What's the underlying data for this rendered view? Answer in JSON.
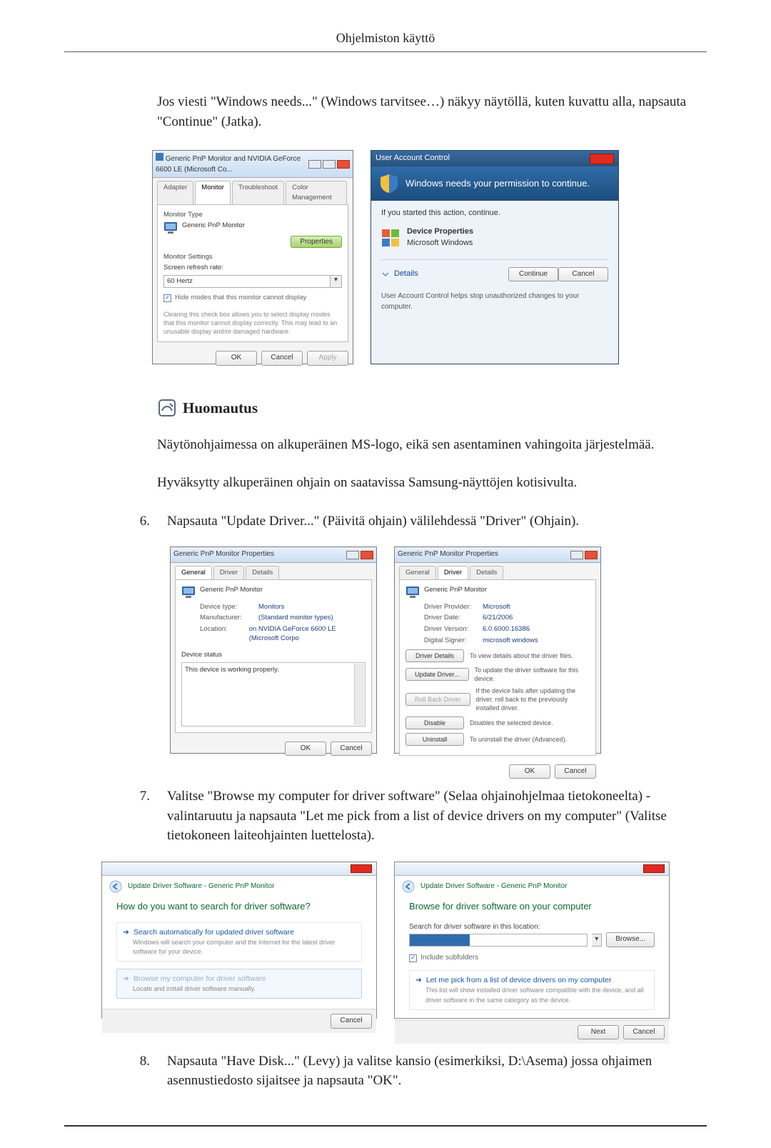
{
  "running_head": "Ohjelmiston käyttö",
  "para1": "Jos viesti \"Windows needs...\" (Windows tarvitsee…) näkyy näytöllä, kuten kuvattu alla, napsauta \"Continue\" (Jatka).",
  "note": {
    "heading": "Huomautus",
    "p1": "Näytönohjaimessa on alkuperäinen MS-logo, eikä sen asentaminen vahingoita järjestelmää.",
    "p2": "Hyväksytty alkuperäinen ohjain on saatavissa Samsung-näyttöjen kotisivulta."
  },
  "steps": {
    "s6": {
      "num": "6.",
      "text": "Napsauta \"Update Driver...\" (Päivitä ohjain) välilehdessä \"Driver\" (Ohjain)."
    },
    "s7": {
      "num": "7.",
      "text": "Valitse \"Browse my computer for driver software\" (Selaa ohjainohjelmaa tietokoneelta) -valintaruutu ja napsauta \"Let me pick from a list of device drivers on my computer\" (Valitse tietokoneen laiteohjainten luettelosta)."
    },
    "s8": {
      "num": "8.",
      "text": "Napsauta \"Have Disk...\" (Levy) ja valitse kansio (esimerkiksi, D:\\Asema) jossa ohjaimen asennustiedosto sijaitsee ja napsauta \"OK\"."
    }
  },
  "adapter_dialog": {
    "title": "Generic PnP Monitor and NVIDIA GeForce 6600 LE (Microsoft Co...",
    "tabs": [
      "Adapter",
      "Monitor",
      "Troubleshoot",
      "Color Management"
    ],
    "section1_label": "Monitor Type",
    "monitor_name": "Generic PnP Monitor",
    "properties_btn": "Properties",
    "section2_label": "Monitor Settings",
    "refresh_label": "Screen refresh rate:",
    "refresh_value": "60 Hertz",
    "hide_modes_check": "Hide modes that this monitor cannot display",
    "hide_modes_note": "Clearing this check box allows you to select display modes that this monitor cannot display correctly. This may lead to an unusable display and/or damaged hardware.",
    "ok": "OK",
    "cancel": "Cancel",
    "apply": "Apply"
  },
  "uac": {
    "titlebar": "User Account Control",
    "banner": "Windows needs your permission to continue.",
    "line1": "If you started this action, continue.",
    "app_name": "Device Properties",
    "app_publisher": "Microsoft Windows",
    "details": "Details",
    "continue": "Continue",
    "cancel": "Cancel",
    "footer": "User Account Control helps stop unauthorized changes to your computer."
  },
  "monprop_general": {
    "title": "Generic PnP Monitor Properties",
    "tabs": [
      "General",
      "Driver",
      "Details"
    ],
    "monitor_name": "Generic PnP Monitor",
    "kv": {
      "devtype_k": "Device type:",
      "devtype_v": "Monitors",
      "manu_k": "Manufacturer:",
      "manu_v": "(Standard monitor types)",
      "loc_k": "Location:",
      "loc_v": "on NVIDIA GeForce 6600 LE (Microsoft Corpo"
    },
    "status_label": "Device status",
    "status_text": "This device is working properly.",
    "ok": "OK",
    "cancel": "Cancel"
  },
  "monprop_driver": {
    "title": "Generic PnP Monitor Properties",
    "tabs": [
      "General",
      "Driver",
      "Details"
    ],
    "monitor_name": "Generic PnP Monitor",
    "kv": {
      "prov_k": "Driver Provider:",
      "prov_v": "Microsoft",
      "date_k": "Driver Date:",
      "date_v": "6/21/2006",
      "ver_k": "Driver Version:",
      "ver_v": "6.0.6000.16386",
      "sign_k": "Digital Signer:",
      "sign_v": "microsoft windows"
    },
    "buttons": {
      "details": {
        "label": "Driver Details",
        "desc": "To view details about the driver files."
      },
      "update": {
        "label": "Update Driver...",
        "desc": "To update the driver software for this device."
      },
      "rollback": {
        "label": "Roll Back Driver",
        "desc": "If the device fails after updating the driver, roll back to the previously installed driver."
      },
      "disable": {
        "label": "Disable",
        "desc": "Disables the selected device."
      },
      "uninstall": {
        "label": "Uninstall",
        "desc": "To uninstall the driver (Advanced)."
      }
    },
    "ok": "OK",
    "cancel": "Cancel"
  },
  "wizard1": {
    "crumb": "Update Driver Software - Generic PnP Monitor",
    "headline": "How do you want to search for driver software?",
    "opt1_title": "Search automatically for updated driver software",
    "opt1_sub": "Windows will search your computer and the Internet for the latest driver software for your device.",
    "opt2_title": "Browse my computer for driver software",
    "opt2_sub": "Locate and install driver software manually.",
    "cancel": "Cancel"
  },
  "wizard2": {
    "crumb": "Update Driver Software - Generic PnP Monitor",
    "headline": "Browse for driver software on your computer",
    "search_label": "Search for driver software in this location:",
    "browse": "Browse...",
    "include_sub": "Include subfolders",
    "opt_title": "Let me pick from a list of device drivers on my computer",
    "opt_sub": "This list will show installed driver software compatible with the device, and all driver software in the same category as the device.",
    "next": "Next",
    "cancel": "Cancel"
  }
}
